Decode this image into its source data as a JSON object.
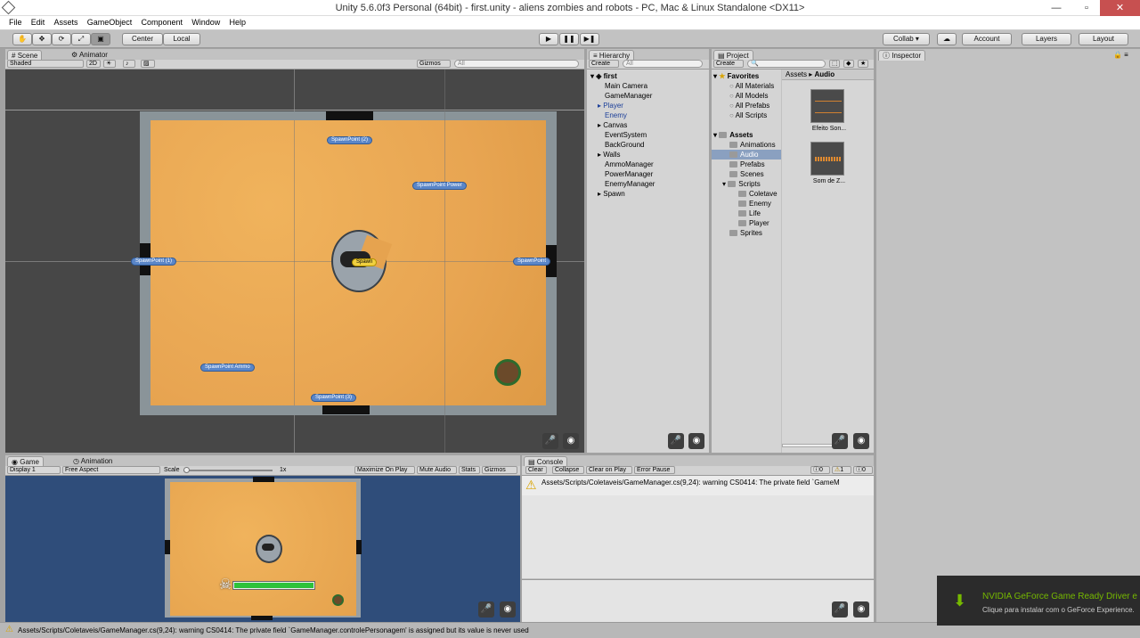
{
  "window": {
    "title": "Unity 5.6.0f3 Personal (64bit) - first.unity - aliens zombies and robots - PC, Mac & Linux Standalone <DX11>"
  },
  "menu": [
    "File",
    "Edit",
    "Assets",
    "GameObject",
    "Component",
    "Window",
    "Help"
  ],
  "toolbar": {
    "center": "Center",
    "local": "Local",
    "collab": "Collab ▾",
    "account": "Account",
    "layers": "Layers",
    "layout": "Layout"
  },
  "scene": {
    "tab": "Scene",
    "tab2": "Animator",
    "shading": "Shaded",
    "mode2d": "2D",
    "gizmos": "Gizmos",
    "search": "All",
    "markers": {
      "sp2": "SpawnPoint (2)",
      "spp": "SpawnPoint Power",
      "sp1": "SpawnPoint (1)",
      "sp": "SpawnPoint",
      "spawn": "Spawn",
      "spa": "SpawnPoint Ammo",
      "sp3": "SpawnPoint (3)"
    }
  },
  "hierarchy": {
    "tab": "Hierarchy",
    "create": "Create",
    "search": "All",
    "scene": "first",
    "items": [
      "Main Camera",
      "GameManager",
      "Player",
      "Enemy",
      "Canvas",
      "EventSystem",
      "BackGround",
      "Walls",
      "AmmoManager",
      "PowerManager",
      "EnemyManager",
      "Spawn"
    ]
  },
  "project": {
    "tab": "Project",
    "create": "Create",
    "favorites": "Favorites",
    "fav_items": [
      "All Materials",
      "All Models",
      "All Prefabs",
      "All Scripts"
    ],
    "assets": "Assets",
    "folders": [
      "Animations",
      "Audio",
      "Prefabs",
      "Scenes",
      "Scripts",
      "Coletave",
      "Enemy",
      "Life",
      "Player",
      "Sprites"
    ],
    "breadcrumb_root": "Assets",
    "breadcrumb_sep": "▸",
    "breadcrumb_leaf": "Audio",
    "files": [
      "Efeito Son...",
      "Som de Z..."
    ]
  },
  "inspector": {
    "tab": "Inspector"
  },
  "game": {
    "tab": "Game",
    "tab2": "Animation",
    "display": "Display 1",
    "aspect": "Free Aspect",
    "scale": "Scale",
    "scale_val": "1x",
    "max": "Maximize On Play",
    "mute": "Mute Audio",
    "stats": "Stats",
    "gizmos": "Gizmos"
  },
  "console": {
    "tab": "Console",
    "clear": "Clear",
    "collapse": "Collapse",
    "clear_play": "Clear on Play",
    "error_pause": "Error Pause",
    "count_info": "0",
    "count_warn": "1",
    "count_err": "0",
    "message": "Assets/Scripts/Coletaveis/GameManager.cs(9,24): warning CS0414: The private field `GameM"
  },
  "status": "Assets/Scripts/Coletaveis/GameManager.cs(9,24): warning CS0414: The private field `GameManager.controlePersonagem' is assigned but its value is never used",
  "notification": {
    "title": "NVIDIA GeForce Game Ready Driver e",
    "subtitle": "Clique para instalar com o GeForce Experience."
  }
}
